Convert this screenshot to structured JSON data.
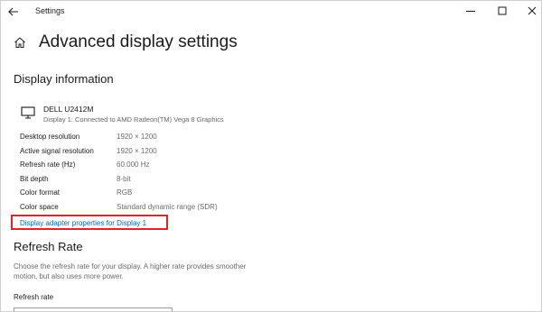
{
  "window": {
    "title": "Settings"
  },
  "header": {
    "title": "Advanced display settings"
  },
  "display_info": {
    "section_title": "Display information",
    "monitor_name": "DELL U2412M",
    "monitor_desc": "Display 1: Connected to AMD Radeon(TM) Vega 8 Graphics",
    "rows": [
      {
        "label": "Desktop resolution",
        "value": "1920 × 1200"
      },
      {
        "label": "Active signal resolution",
        "value": "1920 × 1200"
      },
      {
        "label": "Refresh rate (Hz)",
        "value": "60.000 Hz"
      },
      {
        "label": "Bit depth",
        "value": "8-bit"
      },
      {
        "label": "Color format",
        "value": "RGB"
      },
      {
        "label": "Color space",
        "value": "Standard dynamic range (SDR)"
      }
    ],
    "adapter_link": "Display adapter properties for Display 1"
  },
  "refresh_rate": {
    "section_title": "Refresh Rate",
    "description": "Choose the refresh rate for your display. A higher rate provides smoother motion, but also uses more power.",
    "field_label": "Refresh rate"
  },
  "icons": {
    "back": "back-arrow-icon",
    "minimize": "minimize-icon",
    "maximize": "maximize-icon",
    "close": "close-icon",
    "home": "home-icon",
    "monitor": "monitor-icon"
  },
  "colors": {
    "link": "#0067b8",
    "highlight": "#e0242b"
  }
}
